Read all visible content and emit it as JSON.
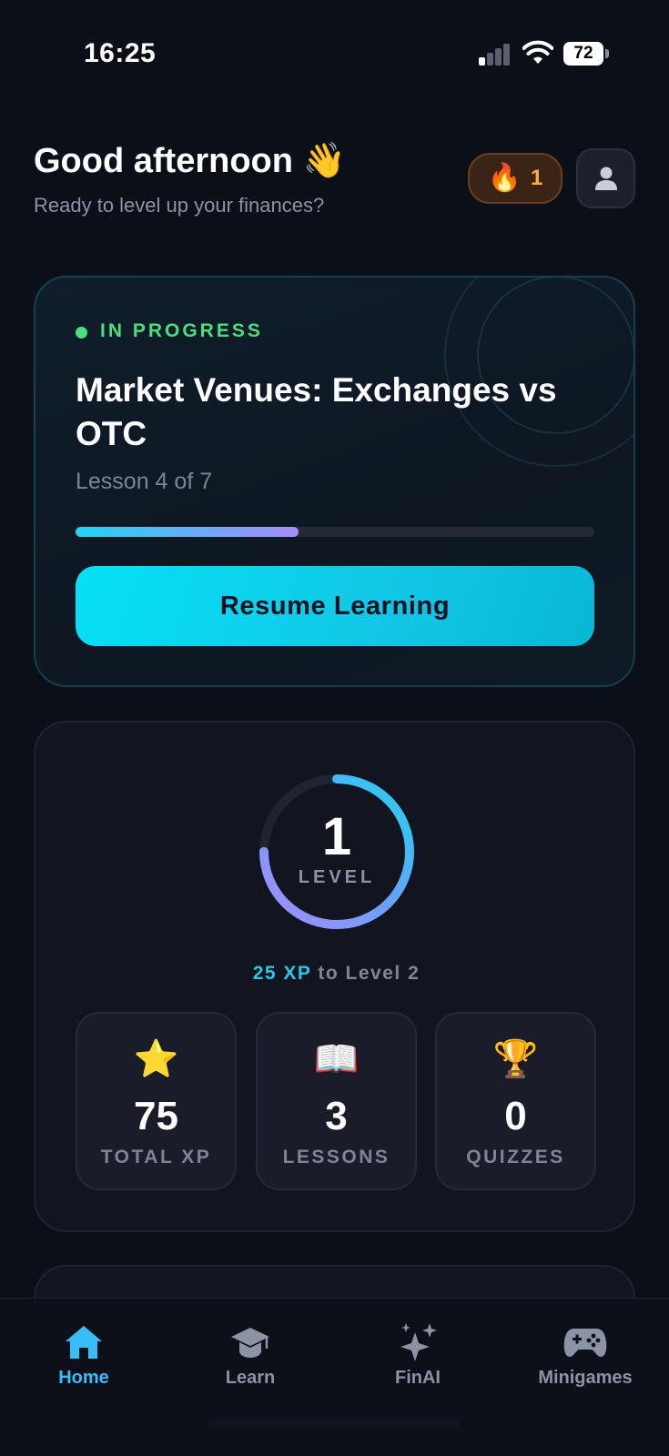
{
  "status_bar": {
    "time": "16:25",
    "battery": "72"
  },
  "header": {
    "greeting": "Good afternoon 👋",
    "subtitle": "Ready to level up your finances?",
    "streak_icon": "🔥",
    "streak_count": "1",
    "profile_icon": "user-icon"
  },
  "progress_card": {
    "status": "IN PROGRESS",
    "course_title": "Market Venues: Exchanges vs OTC",
    "lesson_label": "Lesson 4 of 7",
    "progress_fraction": 0.43,
    "resume_label": "Resume Learning"
  },
  "level_card": {
    "level": "1",
    "level_label": "LEVEL",
    "ring_fraction": 0.75,
    "xp_amount": "25 XP",
    "xp_suffix": " to Level 2",
    "stats": [
      {
        "icon": "⭐",
        "value": "75",
        "label": "TOTAL XP"
      },
      {
        "icon": "📖",
        "value": "3",
        "label": "LESSONS"
      },
      {
        "icon": "🏆",
        "value": "0",
        "label": "QUIZZES"
      }
    ]
  },
  "tab_bar": {
    "tabs": [
      {
        "label": "Home",
        "icon": "home-icon",
        "active": true
      },
      {
        "label": "Learn",
        "icon": "graduation-cap-icon",
        "active": false
      },
      {
        "label": "FinAI",
        "icon": "sparkles-icon",
        "active": false
      },
      {
        "label": "Minigames",
        "icon": "gamepad-icon",
        "active": false
      }
    ]
  },
  "colors": {
    "background": "#0b0f18",
    "accent_cyan": "#22d3ee",
    "accent_green": "#4ade80",
    "accent_purple": "#a78bfa",
    "streak_orange": "#ffae4a"
  }
}
